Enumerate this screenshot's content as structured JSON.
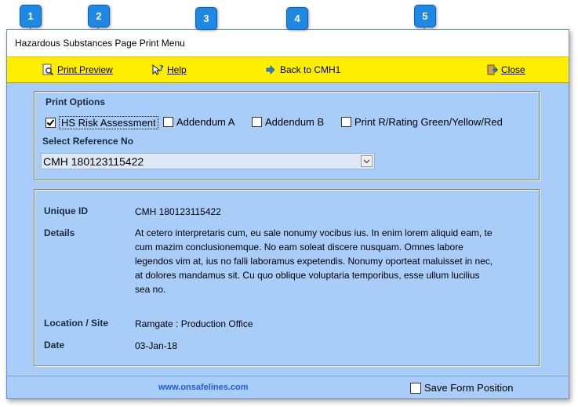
{
  "window": {
    "title": "Hazardous Substances Page Print Menu"
  },
  "toolbar": {
    "print_preview": "Print Preview",
    "help": "Help",
    "back": "Back to CMH1",
    "close": "Close"
  },
  "print_options": {
    "title": "Print Options",
    "checkboxes": [
      {
        "label": "HS Risk Assessment",
        "checked": true
      },
      {
        "label": "Addendum A",
        "checked": false
      },
      {
        "label": "Addendum B",
        "checked": false
      },
      {
        "label": "Print R/Rating Green/Yellow/Red",
        "checked": false
      }
    ],
    "select_label": "Select Reference No",
    "select_value": "CMH 180123115422"
  },
  "details": {
    "unique_id_label": "Unique ID",
    "unique_id": "CMH 180123115422",
    "details_label": "Details",
    "details_text": "At cetero interpretaris cum, eu sale nonumy vocibus ius. In enim lorem aliquid eam, te cum mazim conclusionemque. No eam soleat discere nusquam. Omnes labore legendos vim at, ius no falli laboramus expetendis. Nonumy oporteat maluisset in nec, at dolores mandamus sit. Cu quo oblique voluptaria temporibus, esse ullum lucilius sea no.",
    "location_label": "Location / Site",
    "location": "Ramgate : Production Office",
    "date_label": "Date",
    "date": "03-Jan-18"
  },
  "footer": {
    "link": "www.onsafelines.com",
    "save_position": "Save Form Position"
  },
  "markers": [
    "1",
    "2",
    "3",
    "4",
    "5"
  ],
  "colors": {
    "toolbar": "#ffee00",
    "form_bg": "#a8cdf8",
    "marker": "#1e88e5",
    "link": "#1f5fd0"
  }
}
